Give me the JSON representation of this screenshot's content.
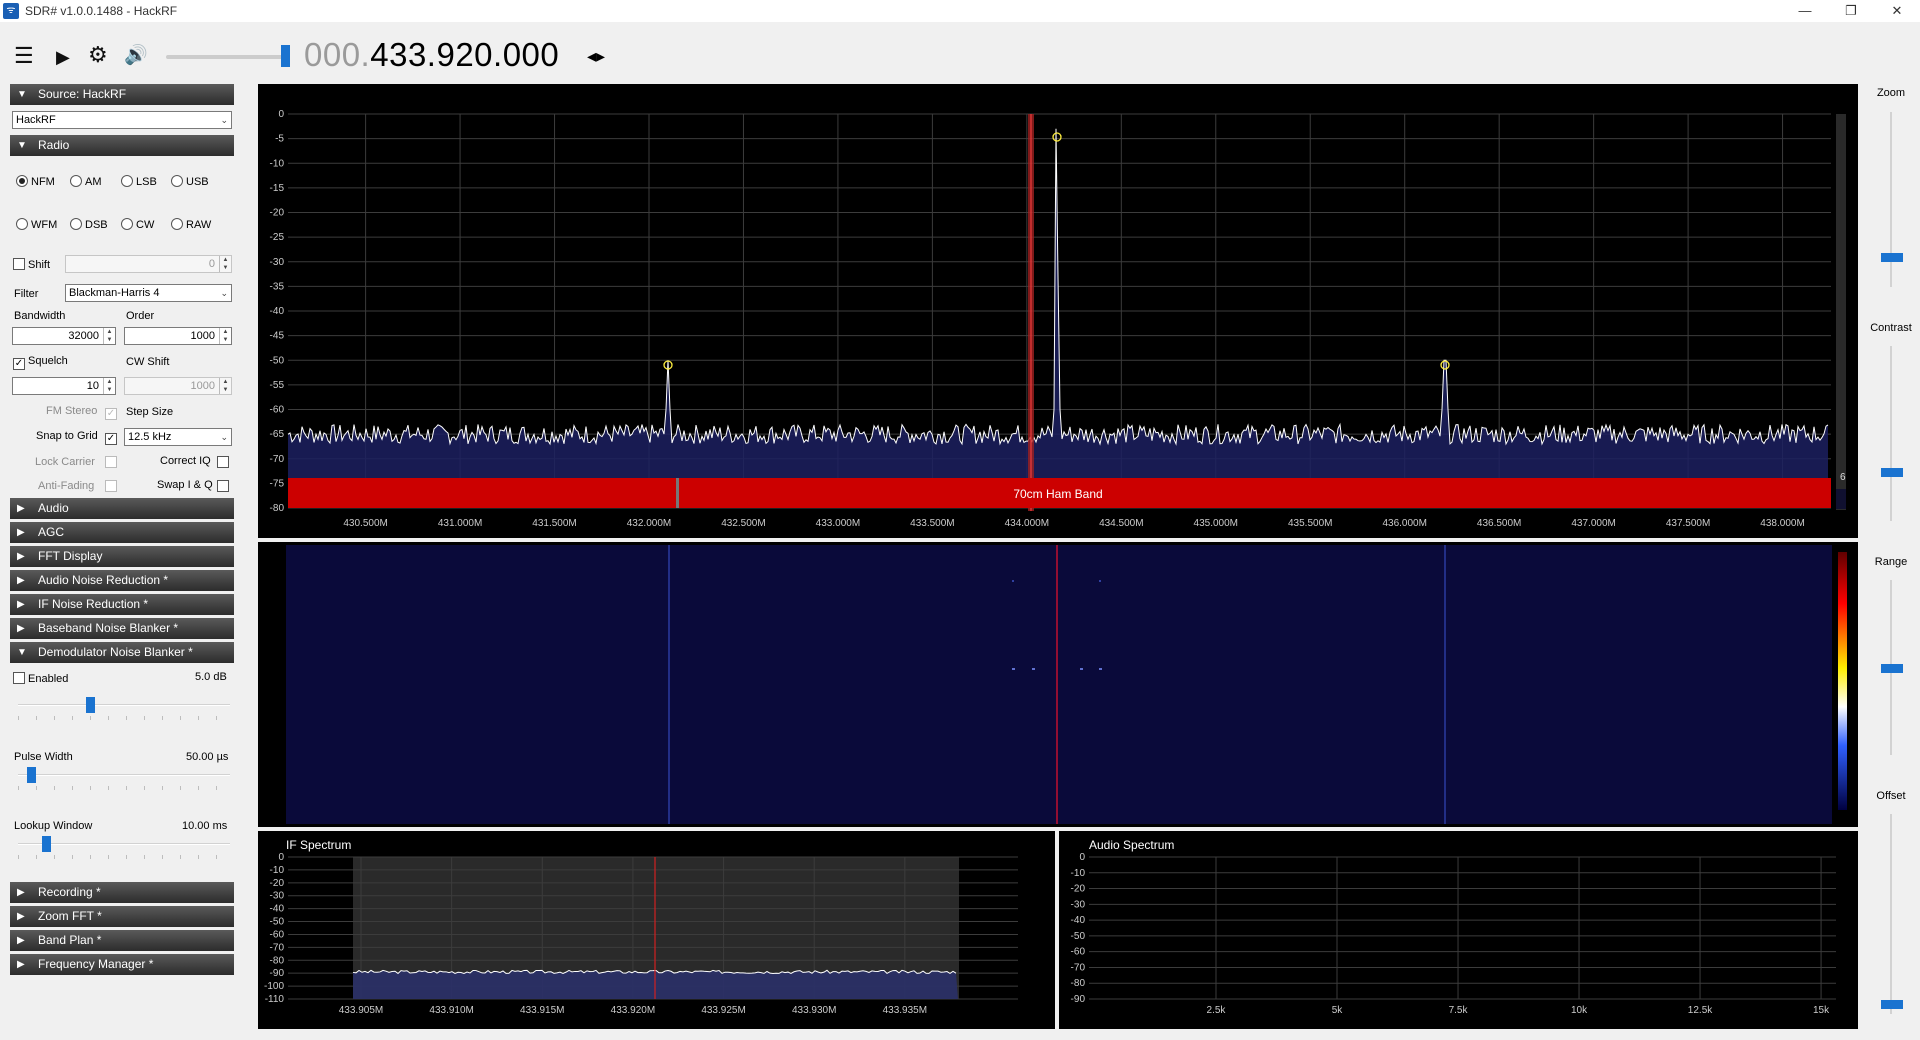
{
  "window": {
    "title": "SDR# v1.0.0.1488 - HackRF",
    "minimize": "—",
    "restore": "❐",
    "close": "✕"
  },
  "toolbar": {
    "menu_icon": "☰",
    "play_icon": "▶",
    "settings_icon": "⚙",
    "volume_icon": "🔊",
    "freq_prefix": "000.",
    "freq_main": "433.920.000",
    "freq_arrows": "◂▸"
  },
  "sidebar": {
    "source_header": "Source: HackRF",
    "source_device": "HackRF",
    "radio_header": "Radio",
    "modes": [
      "NFM",
      "AM",
      "LSB",
      "USB",
      "WFM",
      "DSB",
      "CW",
      "RAW"
    ],
    "selected_mode": "NFM",
    "shift_label": "Shift",
    "shift_value": "0",
    "filter_label": "Filter",
    "filter_value": "Blackman-Harris 4",
    "bandwidth_label": "Bandwidth",
    "bandwidth_value": "32000",
    "order_label": "Order",
    "order_value": "1000",
    "squelch_label": "Squelch",
    "squelch_value": "10",
    "cwshift_label": "CW Shift",
    "cwshift_value": "1000",
    "fmstereo_label": "FM Stereo",
    "stepsize_label": "Step Size",
    "stepsize_value": "12.5 kHz",
    "snap_label": "Snap to Grid",
    "lockcarrier_label": "Lock Carrier",
    "correctiq_label": "Correct IQ",
    "antifading_label": "Anti-Fading",
    "swapiq_label": "Swap I & Q",
    "collapsed": [
      "Audio",
      "AGC",
      "FFT Display",
      "Audio Noise Reduction *",
      "IF Noise Reduction *",
      "Baseband Noise Blanker *"
    ],
    "dnb_header": "Demodulator Noise Blanker *",
    "dnb_enabled_label": "Enabled",
    "dnb_threshold": "5.0 dB",
    "dnb_threshold_level": 0.34,
    "pulse_label": "Pulse Width",
    "pulse_value": "50.00 µs",
    "pulse_level": 0.06,
    "lookup_label": "Lookup Window",
    "lookup_value": "10.00 ms",
    "lookup_level": 0.13,
    "bottom_panels": [
      "Recording *",
      "Zoom FFT *",
      "Band Plan *",
      "Frequency Manager *"
    ]
  },
  "right": {
    "zoom": "Zoom",
    "contrast": "Contrast",
    "range": "Range",
    "offset": "Offset",
    "zoom_level": 0.17,
    "contrast_level": 0.28,
    "range_level": 0.5,
    "offset_level": 0.05
  },
  "spectrum": {
    "y_ticks": [
      "0",
      "-5",
      "-10",
      "-15",
      "-20",
      "-25",
      "-30",
      "-35",
      "-40",
      "-45",
      "-50",
      "-55",
      "-60",
      "-65",
      "-70",
      "-75",
      "-80"
    ],
    "x_ticks": [
      "430.500M",
      "431.000M",
      "431.500M",
      "432.000M",
      "432.500M",
      "433.000M",
      "433.500M",
      "434.000M",
      "434.500M",
      "435.000M",
      "435.500M",
      "436.000M",
      "436.500M",
      "437.000M",
      "437.500M",
      "438.000M"
    ],
    "band_label": "70cm Ham Band",
    "scroll_value": "6"
  },
  "if_spectrum": {
    "title": "IF Spectrum",
    "y_ticks": [
      "0",
      "-10",
      "-20",
      "-30",
      "-40",
      "-50",
      "-60",
      "-70",
      "-80",
      "-90",
      "-100",
      "-110"
    ],
    "x_ticks": [
      "433.905M",
      "433.910M",
      "433.915M",
      "433.920M",
      "433.925M",
      "433.930M",
      "433.935M"
    ]
  },
  "audio_spectrum": {
    "title": "Audio Spectrum",
    "y_ticks": [
      "0",
      "-10",
      "-20",
      "-30",
      "-40",
      "-50",
      "-60",
      "-70",
      "-80",
      "-90"
    ],
    "x_ticks": [
      "2.5k",
      "5k",
      "7.5k",
      "10k",
      "12.5k",
      "15k"
    ]
  },
  "colors": {
    "accent": "#1a73d0",
    "band": "#cc0000",
    "trace": "#ffffff",
    "waterfall": "#0a0a3a"
  }
}
